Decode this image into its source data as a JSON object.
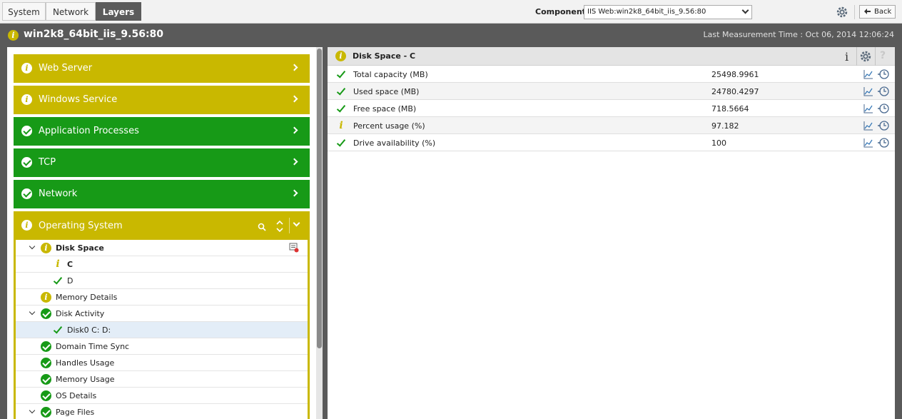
{
  "tabs": [
    {
      "label": "System",
      "active": false
    },
    {
      "label": "Network",
      "active": false
    },
    {
      "label": "Layers",
      "active": true
    }
  ],
  "component": {
    "label": "Component",
    "selected": "IIS Web:win2k8_64bit_iis_9.56:80"
  },
  "toolbar": {
    "back_label": "Back"
  },
  "header": {
    "title": "win2k8_64bit_iis_9.56:80",
    "last_measurement": "Last Measurement Time : Oct 06, 2014 12:06:24"
  },
  "layers": [
    {
      "label": "Web Server",
      "state": "info"
    },
    {
      "label": "Windows Service",
      "state": "info"
    },
    {
      "label": "Application Processes",
      "state": "ok"
    },
    {
      "label": "TCP",
      "state": "ok"
    },
    {
      "label": "Network",
      "state": "ok"
    }
  ],
  "os_layer": {
    "label": "Operating System",
    "tree": [
      {
        "label": "Disk Space",
        "state": "info",
        "level": 0,
        "expanded": true,
        "bold": true
      },
      {
        "label": "C",
        "state": "info",
        "level": 1,
        "bold": true
      },
      {
        "label": "D",
        "state": "ok",
        "level": 1
      },
      {
        "label": "Memory Details",
        "state": "info",
        "level": 0
      },
      {
        "label": "Disk Activity",
        "state": "ok",
        "level": 0,
        "expanded": true
      },
      {
        "label": "Disk0 C: D:",
        "state": "ok",
        "level": 1,
        "selected": true
      },
      {
        "label": "Domain Time Sync",
        "state": "ok",
        "level": 0
      },
      {
        "label": "Handles Usage",
        "state": "ok",
        "level": 0
      },
      {
        "label": "Memory Usage",
        "state": "ok",
        "level": 0
      },
      {
        "label": "OS Details",
        "state": "ok",
        "level": 0
      },
      {
        "label": "Page Files",
        "state": "ok",
        "level": 0,
        "expanded": true
      }
    ]
  },
  "detail": {
    "title": "Disk Space - C",
    "measures": [
      {
        "name": "Total capacity (MB)",
        "value": "25498.9961",
        "state": "ok"
      },
      {
        "name": "Used space (MB)",
        "value": "24780.4297",
        "state": "ok"
      },
      {
        "name": "Free space (MB)",
        "value": "718.5664",
        "state": "ok"
      },
      {
        "name": "Percent usage (%)",
        "value": "97.182",
        "state": "info"
      },
      {
        "name": "Drive availability (%)",
        "value": "100",
        "state": "ok"
      }
    ]
  },
  "colors": {
    "warning": "#c9b800",
    "ok": "#179a17",
    "header_bg": "#5a5a5a"
  }
}
